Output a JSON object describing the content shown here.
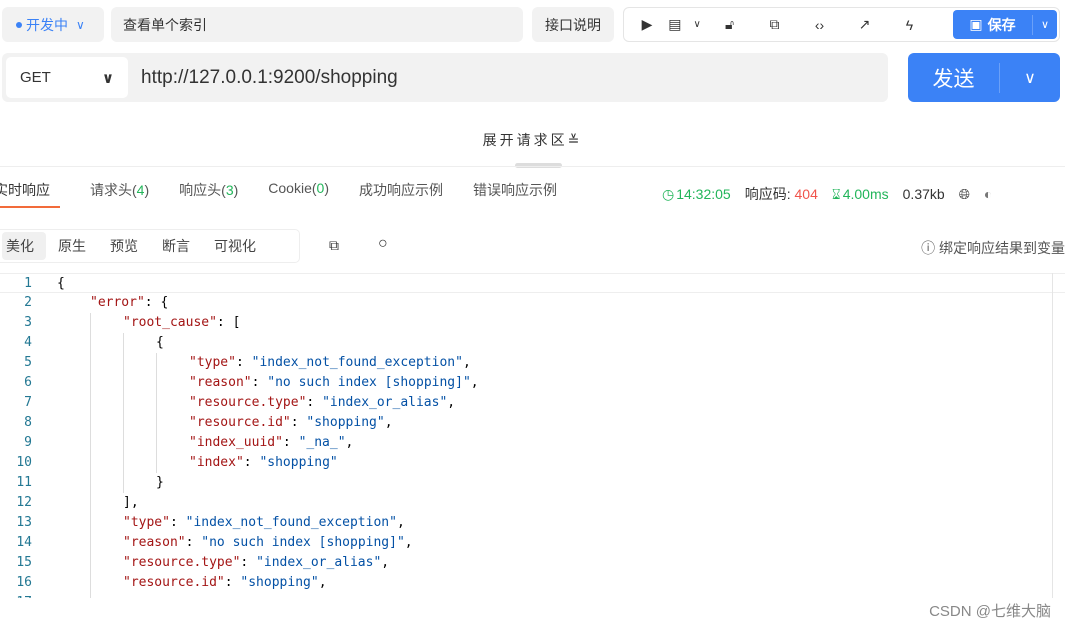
{
  "header": {
    "status": "开发中",
    "name": "查看单个索引",
    "doc_button": "接口说明",
    "save_label": "保存"
  },
  "request": {
    "method": "GET",
    "url": "http://127.0.0.1:9200/shopping",
    "send_label": "发送",
    "expand_label": "展开请求区"
  },
  "response_tabs": [
    {
      "label": "实时响应"
    },
    {
      "label": "请求头",
      "count": "4"
    },
    {
      "label": "响应头",
      "count": "3"
    },
    {
      "label": "Cookie",
      "count": "0"
    },
    {
      "label": "成功响应示例"
    },
    {
      "label": "错误响应示例"
    }
  ],
  "meta": {
    "time": "14:32:05",
    "code_label": "响应码:",
    "code": "404",
    "duration": "4.00ms",
    "size": "0.37kb"
  },
  "colors": {
    "accent": "#3b82f6",
    "success": "#22b55a",
    "error": "#f0544c",
    "tab_underline": "#f26b3a"
  },
  "view_tabs": [
    "美化",
    "原生",
    "预览",
    "断言",
    "可视化"
  ],
  "bind_label": "绑定响应结果到变量",
  "code_lines": [
    {
      "i": 0,
      "t": [
        [
          "p",
          "{"
        ]
      ]
    },
    {
      "i": 1,
      "t": [
        [
          "k",
          "\"error\""
        ],
        [
          "p",
          ": {"
        ]
      ]
    },
    {
      "i": 2,
      "t": [
        [
          "k",
          "\"root_cause\""
        ],
        [
          "p",
          ": ["
        ]
      ]
    },
    {
      "i": 3,
      "t": [
        [
          "p",
          "{"
        ]
      ]
    },
    {
      "i": 4,
      "t": [
        [
          "k",
          "\"type\""
        ],
        [
          "p",
          ": "
        ],
        [
          "s",
          "\"index_not_found_exception\""
        ],
        [
          "p",
          ","
        ]
      ]
    },
    {
      "i": 4,
      "t": [
        [
          "k",
          "\"reason\""
        ],
        [
          "p",
          ": "
        ],
        [
          "s",
          "\"no such index [shopping]\""
        ],
        [
          "p",
          ","
        ]
      ]
    },
    {
      "i": 4,
      "t": [
        [
          "k",
          "\"resource.type\""
        ],
        [
          "p",
          ": "
        ],
        [
          "s",
          "\"index_or_alias\""
        ],
        [
          "p",
          ","
        ]
      ]
    },
    {
      "i": 4,
      "t": [
        [
          "k",
          "\"resource.id\""
        ],
        [
          "p",
          ": "
        ],
        [
          "s",
          "\"shopping\""
        ],
        [
          "p",
          ","
        ]
      ]
    },
    {
      "i": 4,
      "t": [
        [
          "k",
          "\"index_uuid\""
        ],
        [
          "p",
          ": "
        ],
        [
          "s",
          "\"_na_\""
        ],
        [
          "p",
          ","
        ]
      ]
    },
    {
      "i": 4,
      "t": [
        [
          "k",
          "\"index\""
        ],
        [
          "p",
          ": "
        ],
        [
          "s",
          "\"shopping\""
        ]
      ]
    },
    {
      "i": 3,
      "t": [
        [
          "p",
          "}"
        ]
      ]
    },
    {
      "i": 2,
      "t": [
        [
          "p",
          "],"
        ]
      ]
    },
    {
      "i": 2,
      "t": [
        [
          "k",
          "\"type\""
        ],
        [
          "p",
          ": "
        ],
        [
          "s",
          "\"index_not_found_exception\""
        ],
        [
          "p",
          ","
        ]
      ]
    },
    {
      "i": 2,
      "t": [
        [
          "k",
          "\"reason\""
        ],
        [
          "p",
          ": "
        ],
        [
          "s",
          "\"no such index [shopping]\""
        ],
        [
          "p",
          ","
        ]
      ]
    },
    {
      "i": 2,
      "t": [
        [
          "k",
          "\"resource.type\""
        ],
        [
          "p",
          ": "
        ],
        [
          "s",
          "\"index_or_alias\""
        ],
        [
          "p",
          ","
        ]
      ]
    },
    {
      "i": 2,
      "t": [
        [
          "k",
          "\"resource.id\""
        ],
        [
          "p",
          ": "
        ],
        [
          "s",
          "\"shopping\""
        ],
        [
          "p",
          ","
        ]
      ]
    },
    {
      "i": 2,
      "t": []
    }
  ],
  "watermark": "CSDN @七维大脑"
}
